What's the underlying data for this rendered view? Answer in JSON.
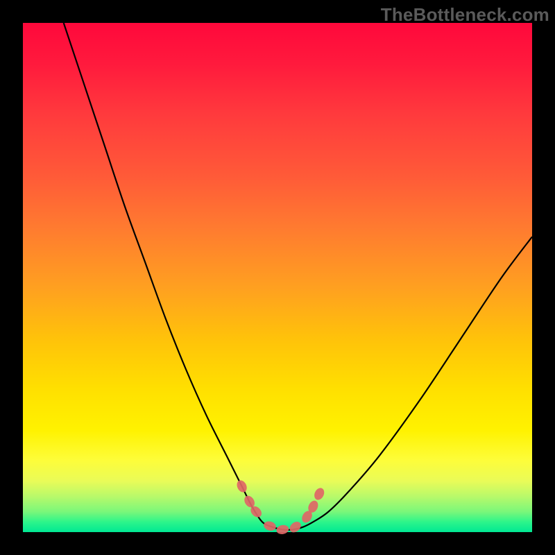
{
  "watermark": "TheBottleneck.com",
  "chart_data": {
    "type": "line",
    "title": "",
    "xlabel": "",
    "ylabel": "",
    "xlim": [
      0,
      100
    ],
    "ylim": [
      0,
      100
    ],
    "grid": false,
    "legend": false,
    "series": [
      {
        "name": "bottleneck-curve",
        "color": "#000000",
        "x": [
          8,
          12,
          16,
          20,
          24,
          28,
          32,
          36,
          40,
          43,
          45,
          47,
          49,
          51,
          53,
          55,
          57,
          60,
          64,
          70,
          78,
          86,
          94,
          100
        ],
        "y": [
          100,
          88,
          76,
          64,
          53,
          42,
          32,
          23,
          15,
          9,
          5,
          2,
          1,
          0.5,
          0.5,
          1,
          2,
          4,
          8,
          15,
          26,
          38,
          50,
          58
        ]
      },
      {
        "name": "optimal-markers",
        "color": "#e06666",
        "type": "scatter",
        "x": [
          43.0,
          44.5,
          45.8,
          48.5,
          51.0,
          53.5,
          55.8,
          57.0,
          58.2
        ],
        "y": [
          9.0,
          6.0,
          4.0,
          1.2,
          0.5,
          1.0,
          3.0,
          5.0,
          7.5
        ]
      }
    ],
    "annotations": []
  },
  "colors": {
    "gradient_top": "#ff083b",
    "gradient_mid": "#ffe000",
    "gradient_bottom": "#00e893",
    "curve": "#000000",
    "marker_fill": "#e06666",
    "frame": "#000000"
  }
}
